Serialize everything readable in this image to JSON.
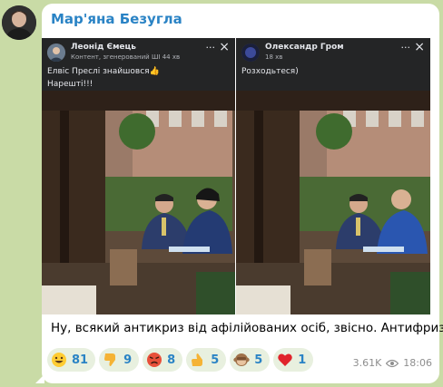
{
  "channel": {
    "sender": "Мар'яна Безугла",
    "avatar_icon": "person-avatar"
  },
  "posts": [
    {
      "author": "Леонід Ємець",
      "meta": "Контент, згенерований ШІ  44 хв",
      "text": "Елвіс Преслі знайшовся👍\nНарешті!!!"
    },
    {
      "author": "Олександр Гром",
      "meta": "18 хв",
      "text": "Розходьтеся)"
    }
  ],
  "caption": "Ну, всякий антикриз від афілійованих осіб, звісно. Антифриз)",
  "reactions": [
    {
      "icon": "grinning-face-icon",
      "count": "81"
    },
    {
      "icon": "thumbs-down-icon",
      "count": "9"
    },
    {
      "icon": "angry-face-icon",
      "count": "8"
    },
    {
      "icon": "thumbs-up-icon",
      "count": "5"
    },
    {
      "icon": "see-no-evil-monkey-icon",
      "count": "5"
    },
    {
      "icon": "red-heart-icon",
      "count": "1"
    }
  ],
  "footer": {
    "views": "3.61K",
    "time": "18:06"
  },
  "colors": {
    "background": "#c9dba6",
    "accent": "#2a83c5",
    "post_bg": "#242526"
  }
}
